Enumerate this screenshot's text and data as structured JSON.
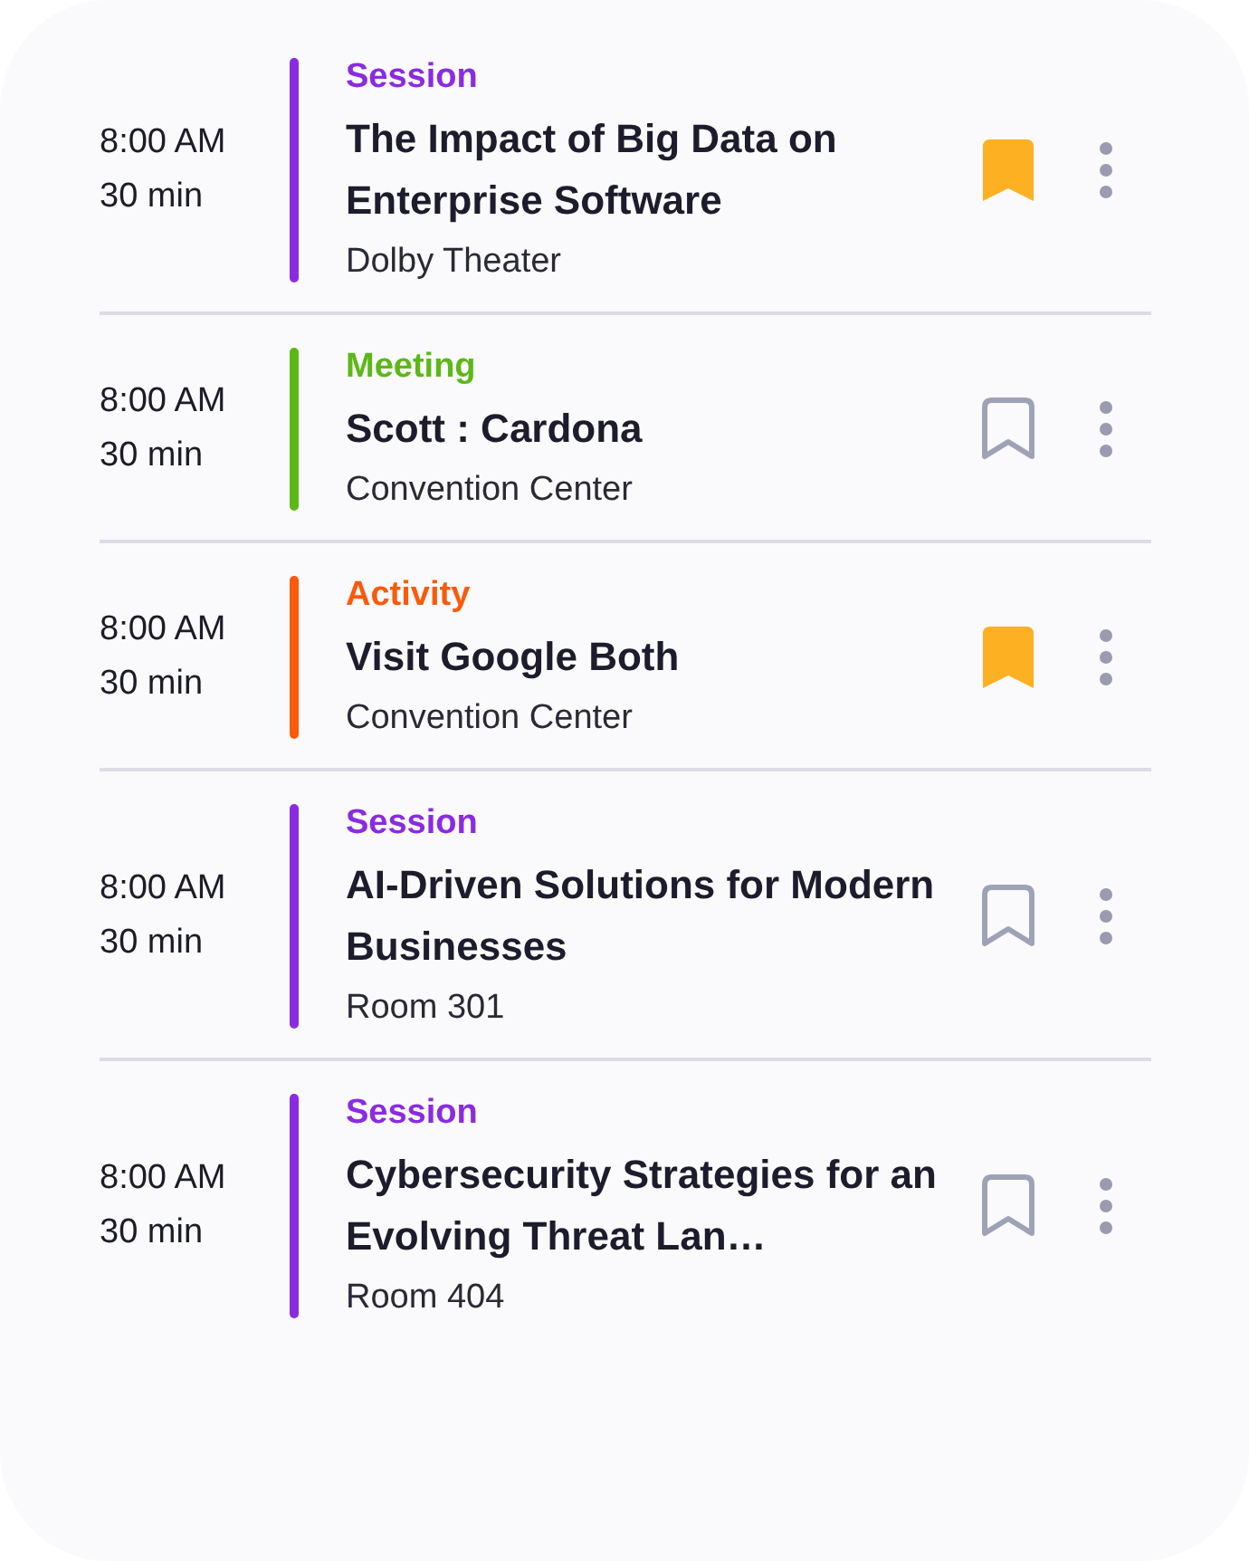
{
  "events": [
    {
      "time": "8:00 AM",
      "duration": "30 min",
      "type": "Session",
      "color": "#8a2be2",
      "title": "The Impact of Big Data on Enterprise Software",
      "location": "Dolby Theater",
      "bookmarked": true
    },
    {
      "time": "8:00 AM",
      "duration": "30 min",
      "type": "Meeting",
      "color": "#5cb818",
      "title": "Scott : Cardona",
      "location": "Convention Center",
      "bookmarked": false
    },
    {
      "time": "8:00 AM",
      "duration": "30 min",
      "type": "Activity",
      "color": "#fa5a0a",
      "title": "Visit Google Both",
      "location": "Convention Center",
      "bookmarked": true
    },
    {
      "time": "8:00 AM",
      "duration": "30 min",
      "type": "Session",
      "color": "#8a2be2",
      "title": "AI-Driven Solutions for Modern Businesses",
      "location": "Room 301",
      "bookmarked": false
    },
    {
      "time": "8:00 AM",
      "duration": "30 min",
      "type": "Session",
      "color": "#8a2be2",
      "title": "Cybersecurity Strategies for an Evolving Threat Lan…",
      "location": "Room 404",
      "bookmarked": false
    }
  ]
}
